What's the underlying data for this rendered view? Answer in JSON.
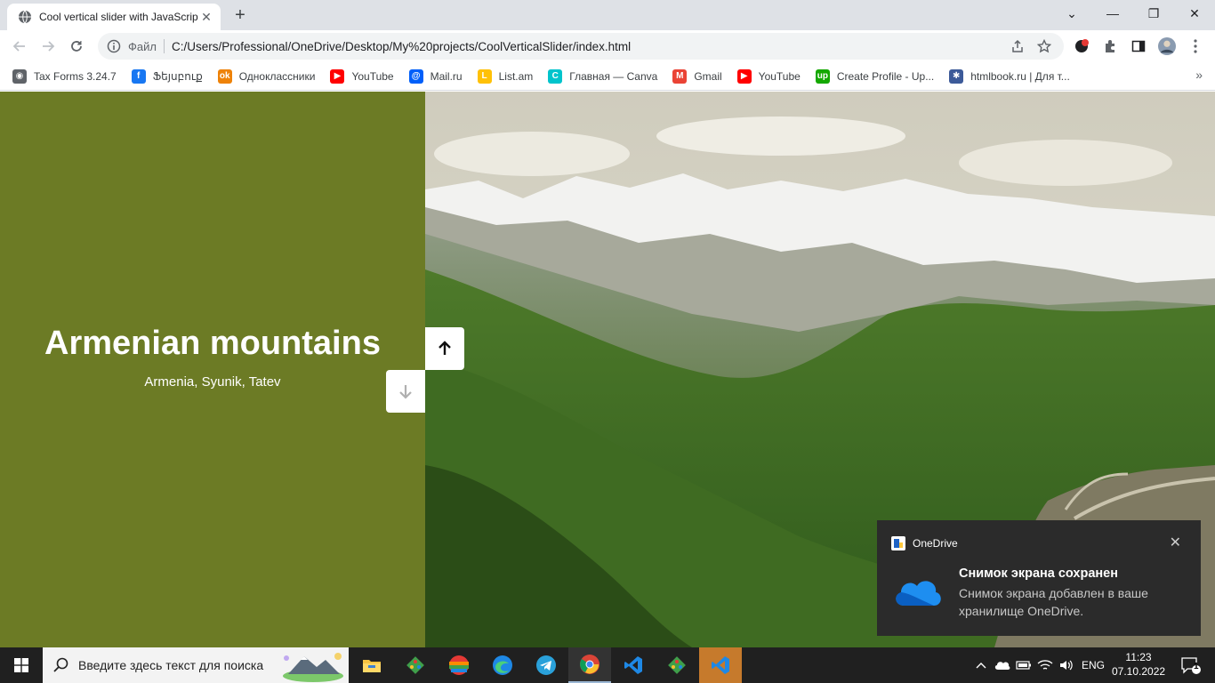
{
  "browser": {
    "tab_title": "Cool vertical slider with JavaScrip",
    "omnibox": {
      "scheme_label": "Файл",
      "url": "C:/Users/Professional/OneDrive/Desktop/My%20projects/CoolVerticalSlider/index.html"
    },
    "bookmarks": [
      {
        "label": "Tax Forms 3.24.7",
        "icon": "globe-icon",
        "color": "#5f6368"
      },
      {
        "label": "Ֆեյսբուք",
        "icon": "facebook-icon",
        "color": "#1877f2"
      },
      {
        "label": "Одноклассники",
        "icon": "odnoklassniki-icon",
        "color": "#ee8208"
      },
      {
        "label": "YouTube",
        "icon": "youtube-icon",
        "color": "#ff0000"
      },
      {
        "label": "Mail.ru",
        "icon": "mailru-icon",
        "color": "#005ff9"
      },
      {
        "label": "List.am",
        "icon": "listam-icon",
        "color": "#ffc107"
      },
      {
        "label": "Главная — Canva",
        "icon": "canva-icon",
        "color": "#00c4cc"
      },
      {
        "label": "Gmail",
        "icon": "gmail-icon",
        "color": "#ea4335"
      },
      {
        "label": "YouTube",
        "icon": "youtube-icon",
        "color": "#ff0000"
      },
      {
        "label": "Create Profile - Up...",
        "icon": "upwork-icon",
        "color": "#14a800"
      },
      {
        "label": "htmlbook.ru | Для т...",
        "icon": "htmlbook-icon",
        "color": "#3c5a99"
      }
    ]
  },
  "slider": {
    "title": "Armenian mountains",
    "subtitle": "Armenia, Syunik, Tatev",
    "left_color": "#6c7b25"
  },
  "notification": {
    "app_name": "OneDrive",
    "title": "Снимок экрана сохранен",
    "body": "Снимок экрана добавлен в ваше хранилище OneDrive."
  },
  "taskbar": {
    "search_placeholder": "Введите здесь текст для поиска",
    "language": "ENG",
    "time": "11:23",
    "date": "07.10.2022",
    "notification_count": "1"
  }
}
